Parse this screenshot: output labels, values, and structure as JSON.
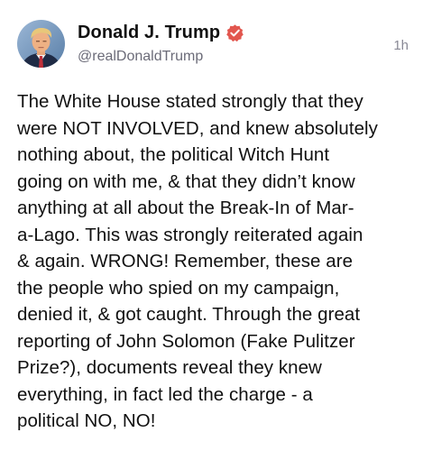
{
  "post": {
    "author": {
      "display_name": "Donald J. Trump",
      "handle": "@realDonaldTrump",
      "verified": true,
      "verified_badge_color": "#e2564e",
      "avatar_icon": "profile-photo"
    },
    "timestamp": "1h",
    "text": "The White House stated strongly that they\nwere NOT INVOLVED, and knew absolutely\nnothing about, the political Witch Hunt\ngoing on with me, & that they didn’t know\nanything at all about the Break-In of Mar-\na-Lago. This was strongly reiterated again\n& again. WRONG! Remember, these are\nthe people who spied on my campaign,\ndenied it, & got caught. Through the great\nreporting of John Solomon (Fake Pulitzer\nPrize?), documents reveal they knew\neverything, in fact led the charge - a\npolitical NO, NO!"
  },
  "colors": {
    "text": "#111111",
    "handle": "#6b6b78",
    "timestamp": "#8a8a96",
    "background": "#ffffff"
  }
}
